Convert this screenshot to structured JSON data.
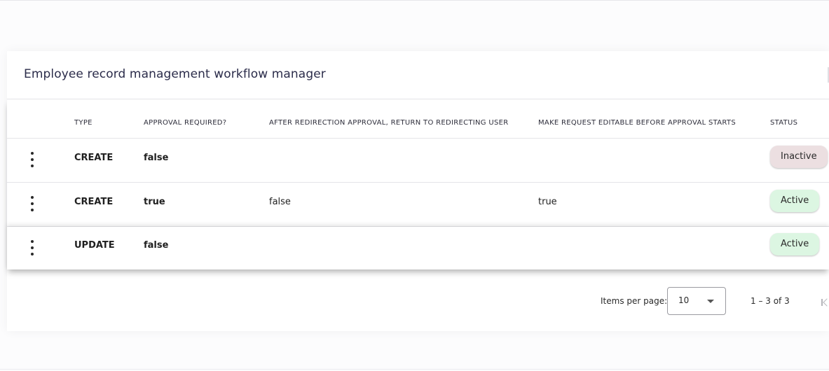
{
  "card": {
    "title": "Employee record management workflow manager"
  },
  "table": {
    "columns": [
      "TYPE",
      "APPROVAL REQUIRED?",
      "AFTER REDIRECTION APPROVAL, RETURN TO REDIRECTING USER",
      "MAKE REQUEST EDITABLE BEFORE APPROVAL STARTS",
      "STATUS"
    ],
    "rows": [
      {
        "type": "CREATE",
        "approval_required": "false",
        "return_to_redirecting_user": "",
        "editable_before_approval": "",
        "status": "Inactive"
      },
      {
        "type": "CREATE",
        "approval_required": "true",
        "return_to_redirecting_user": "false",
        "editable_before_approval": "true",
        "status": "Active"
      },
      {
        "type": "UPDATE",
        "approval_required": "false",
        "return_to_redirecting_user": "",
        "editable_before_approval": "",
        "status": "Active"
      }
    ],
    "row_menu_icon": "more-vertical-icon"
  },
  "paginator": {
    "items_per_page_label": "Items per page:",
    "items_per_page_value": "10",
    "range_label": "1 – 3 of 3",
    "first_page_icon": "first-page-icon"
  },
  "colors": {
    "title": "#2b2c4a",
    "inactive_badge": "#ecdfe1",
    "active_badge": "#dcf6e2"
  }
}
